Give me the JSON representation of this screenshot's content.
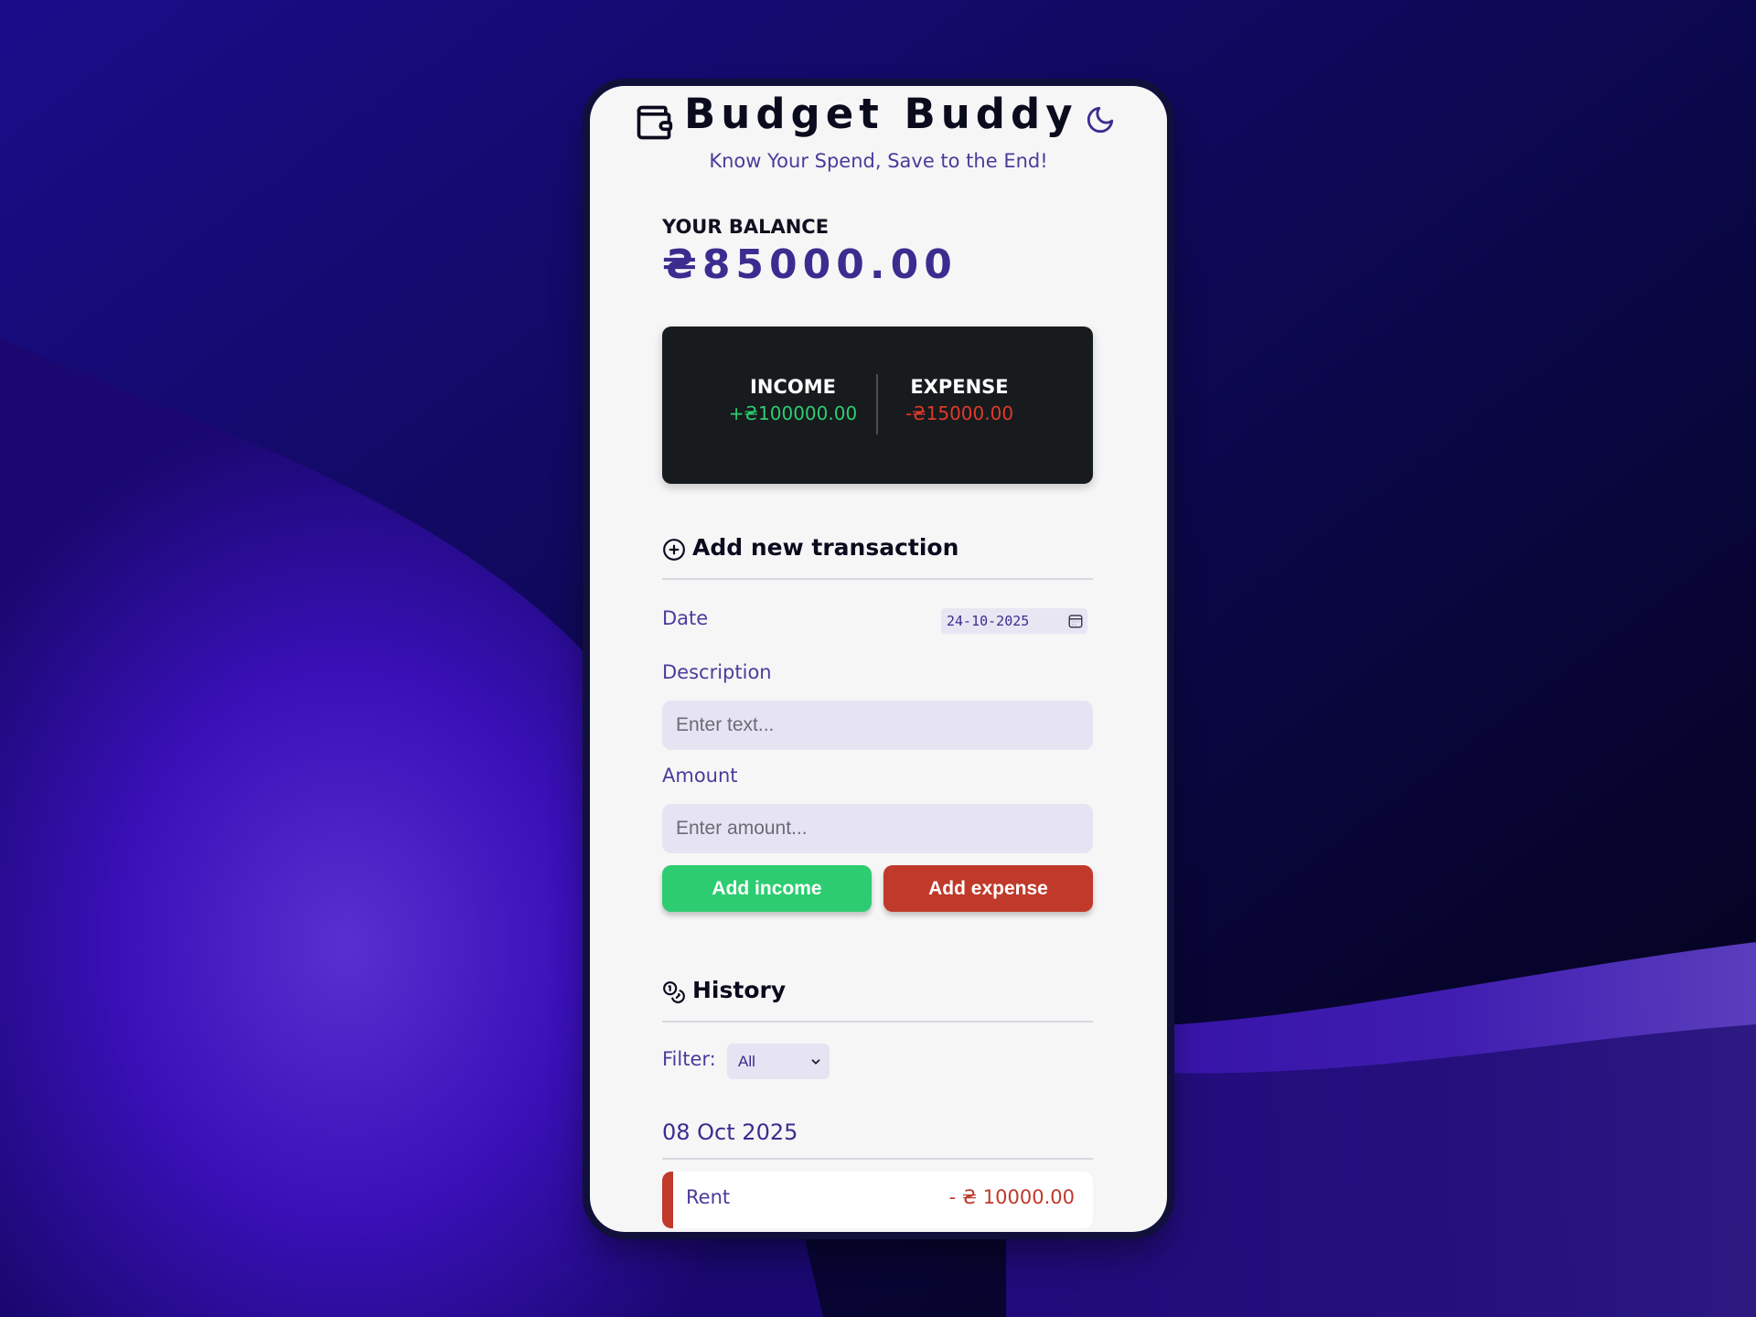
{
  "app": {
    "title": "Budget Buddy",
    "tagline": "Know Your Spend, Save to the End!"
  },
  "balance": {
    "label": "YOUR BALANCE",
    "amount": "₴85000.00"
  },
  "summary": {
    "income_label": "INCOME",
    "income_value": "+₴100000.00",
    "expense_label": "EXPENSE",
    "expense_value": "-₴15000.00"
  },
  "add_transaction": {
    "title": "Add new transaction",
    "date_label": "Date",
    "date_value": "24-10-2025",
    "description_label": "Description",
    "description_placeholder": "Enter text...",
    "amount_label": "Amount",
    "amount_placeholder": "Enter amount...",
    "add_income_label": "Add income",
    "add_expense_label": "Add expense"
  },
  "history": {
    "title": "History",
    "filter_label": "Filter:",
    "filter_value": "All",
    "groups": [
      {
        "date": "08 Oct 2025",
        "items": [
          {
            "description": "Rent",
            "amount": "- ₴ 10000.00",
            "type": "expense"
          }
        ]
      }
    ]
  },
  "colors": {
    "accent": "#3d2c8f",
    "income": "#2ecc71",
    "expense": "#c0392b",
    "card_dark": "#171b1d"
  },
  "icons": {
    "header": "wallet-icon",
    "theme_toggle": "moon-icon",
    "add_section": "plus-circle-icon",
    "history_section": "coins-icon"
  }
}
